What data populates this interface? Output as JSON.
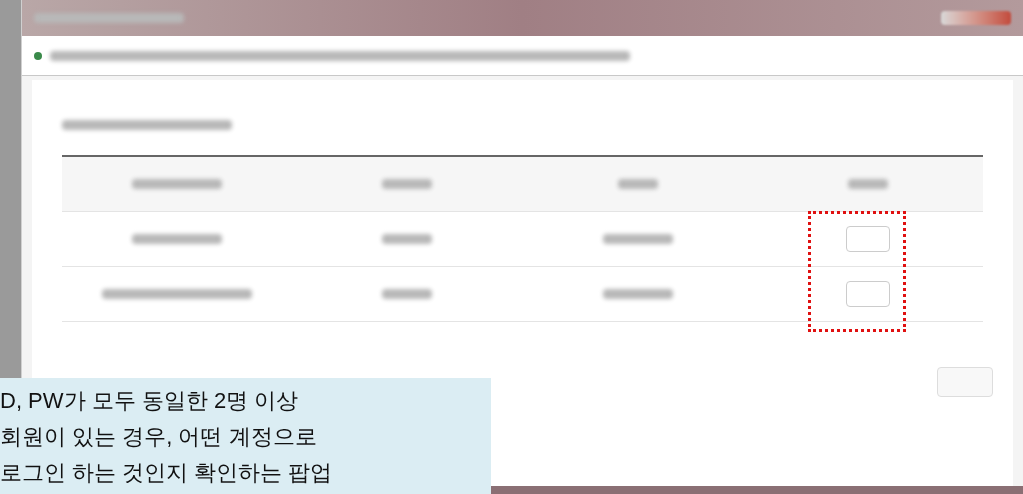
{
  "callout": {
    "lines": [
      "D, PW가 모두 동일한 2명 이상",
      "회원이 있는 경우, 어떤 계정으로",
      "로그인 하는 것인지 확인하는 팝업"
    ]
  }
}
